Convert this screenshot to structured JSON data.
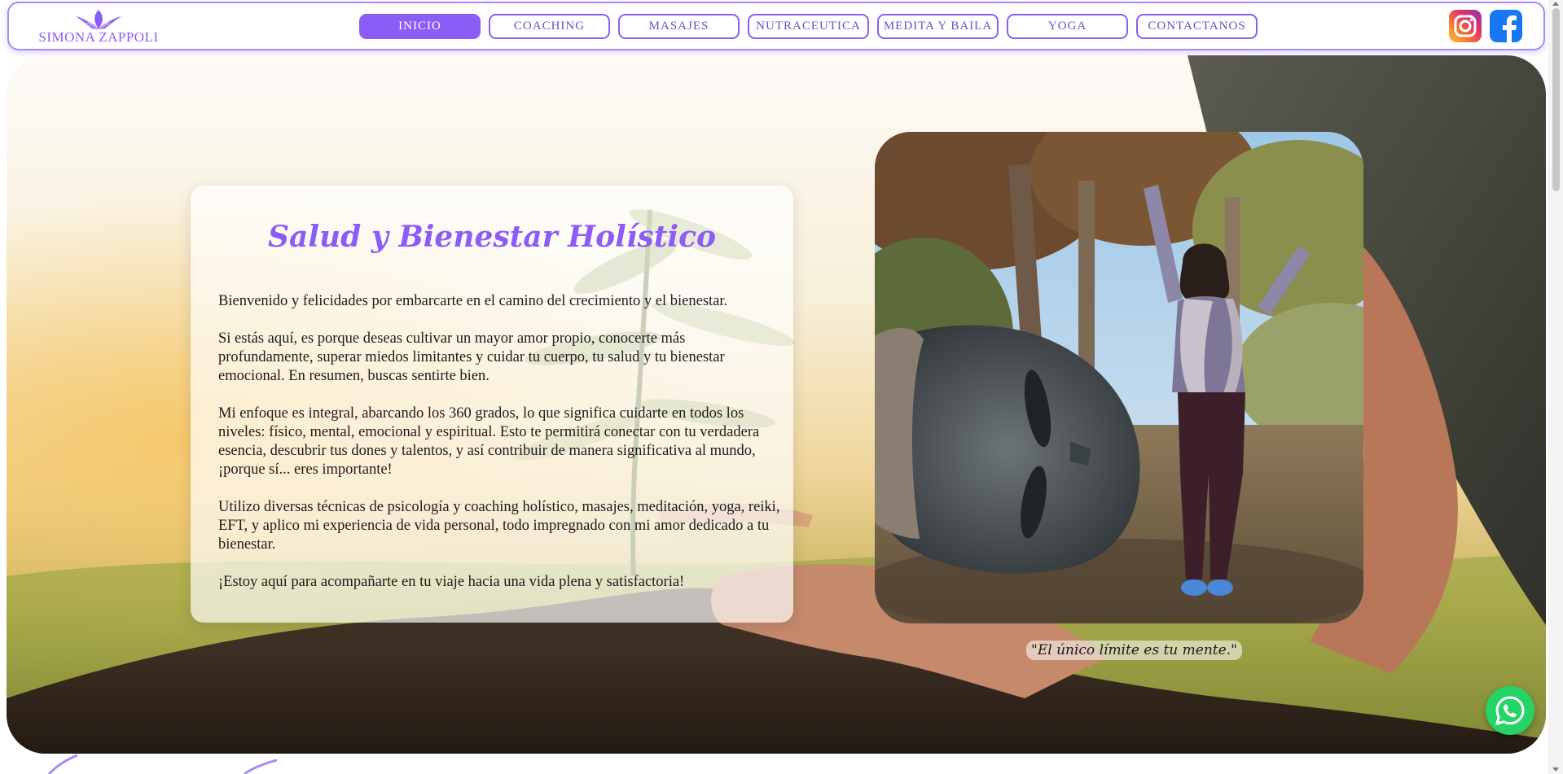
{
  "brand": {
    "logo_text": "SIMONA ZAPPOLI",
    "accent": "#8b5cf6"
  },
  "nav": {
    "items": [
      {
        "label": "INICIO",
        "active": true
      },
      {
        "label": "COACHING",
        "active": false
      },
      {
        "label": "MASAJES",
        "active": false
      },
      {
        "label": "NUTRACEUTICA",
        "active": false
      },
      {
        "label": "MEDITA Y BAILA",
        "active": false
      },
      {
        "label": "YOGA",
        "active": false
      },
      {
        "label": "CONTACTANOS",
        "active": false
      }
    ]
  },
  "social": {
    "icons": [
      "instagram-icon",
      "facebook-icon"
    ]
  },
  "hero": {
    "title": "Salud y Bienestar Holístico",
    "paragraphs": [
      "Bienvenido y felicidades por embarcarte en el camino del crecimiento y el bienestar.",
      "Si estás aquí, es porque deseas cultivar un mayor amor propio, conocerte más profundamente, superar miedos limitantes y cuidar tu cuerpo, tu salud y tu bienestar emocional. En resumen, buscas sentirte bien.",
      "Mi enfoque es integral, abarcando los 360 grados, lo que significa cuidarte en todos los niveles: físico, mental, emocional y espiritual. Esto te permitirá conectar con tu verdadera esencia, descubrir tus dones y talentos, y así contribuir de manera significativa al mundo, ¡porque sí... eres importante!",
      "Utilizo diversas técnicas de psicología y coaching holístico, masajes, meditación, yoga, reiki, EFT, y aplico mi experiencia de vida personal, todo impregnado con mi amor dedicado a tu bienestar.",
      "¡Estoy aquí para acompañarte en tu viaje hacia una vida plena y satisfactoria!"
    ],
    "quote": "\"El único límite es tu mente.\""
  },
  "floating": {
    "whatsapp_icon": "whatsapp-icon",
    "color": "#25d366"
  }
}
